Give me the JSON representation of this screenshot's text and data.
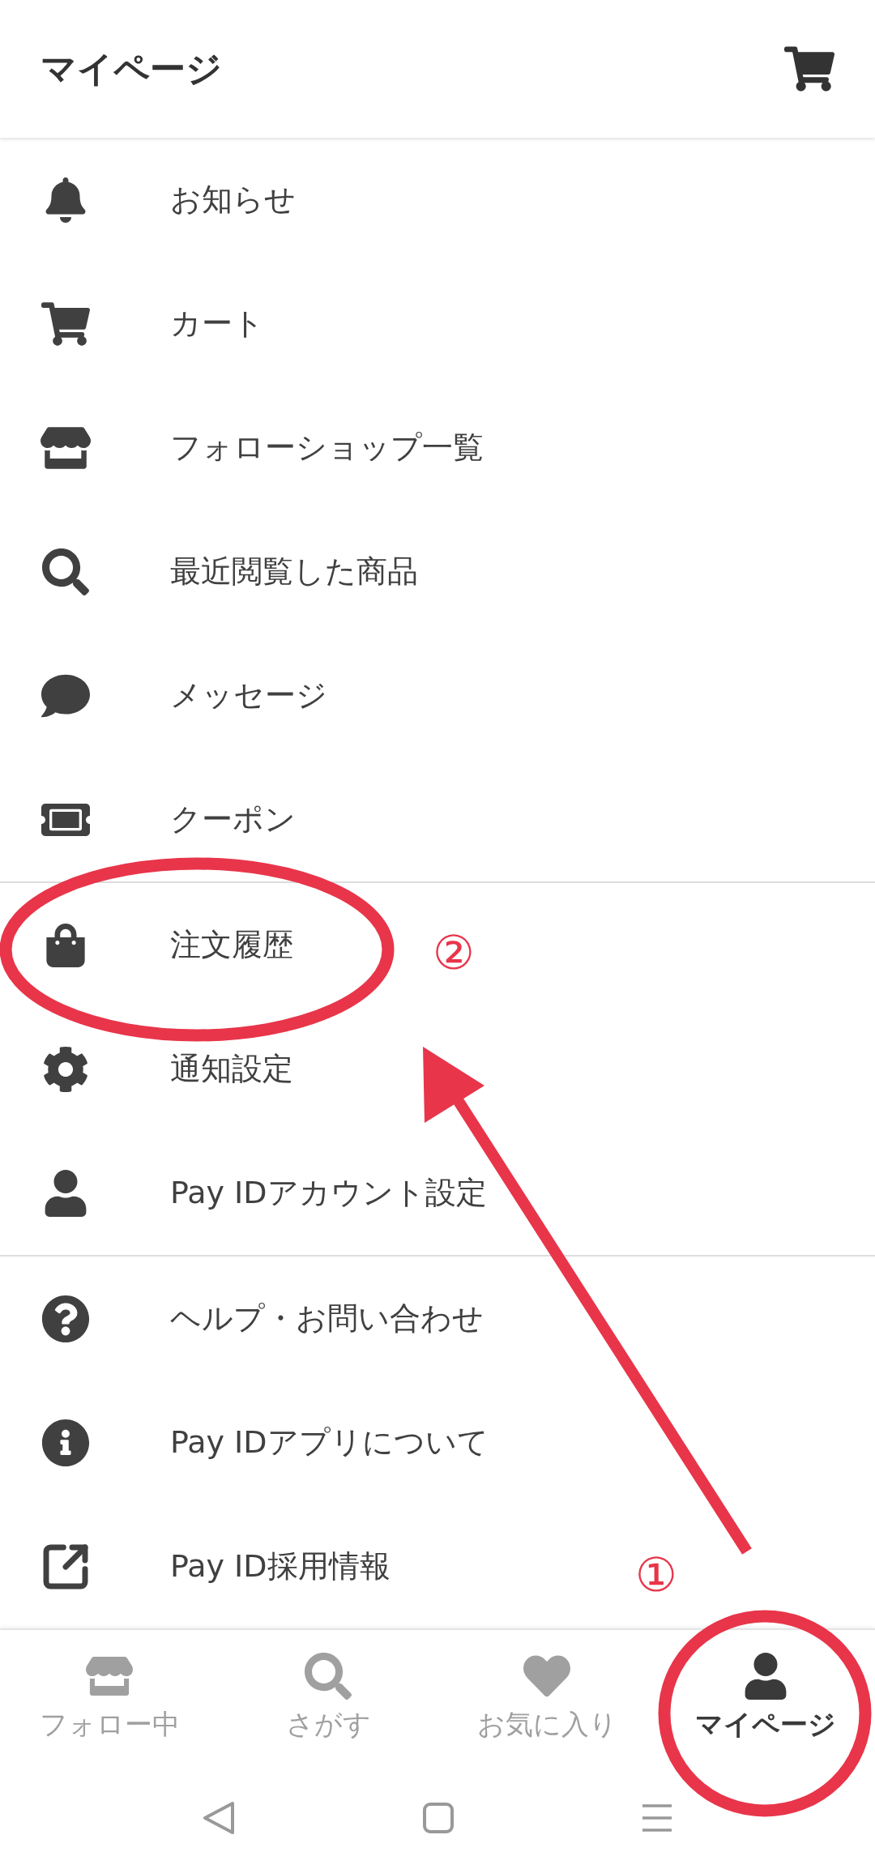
{
  "header": {
    "title": "マイページ"
  },
  "menu_groups": [
    {
      "items": [
        "お知らせ",
        "カート",
        "フォローショップ一覧",
        "最近閲覧した商品",
        "メッセージ",
        "クーポン"
      ]
    },
    {
      "items": [
        "注文履歴",
        "通知設定",
        "Pay IDアカウント設定"
      ]
    },
    {
      "items": [
        "ヘルプ・お問い合わせ",
        "Pay IDアプリについて",
        "Pay ID採用情報"
      ]
    }
  ],
  "bottom_nav": [
    {
      "label": "フォロー中",
      "selected": false
    },
    {
      "label": "さがす",
      "selected": false
    },
    {
      "label": "お気に入り",
      "selected": false
    },
    {
      "label": "マイページ",
      "selected": true
    }
  ],
  "annotations": {
    "markers": [
      "①",
      "②"
    ]
  }
}
